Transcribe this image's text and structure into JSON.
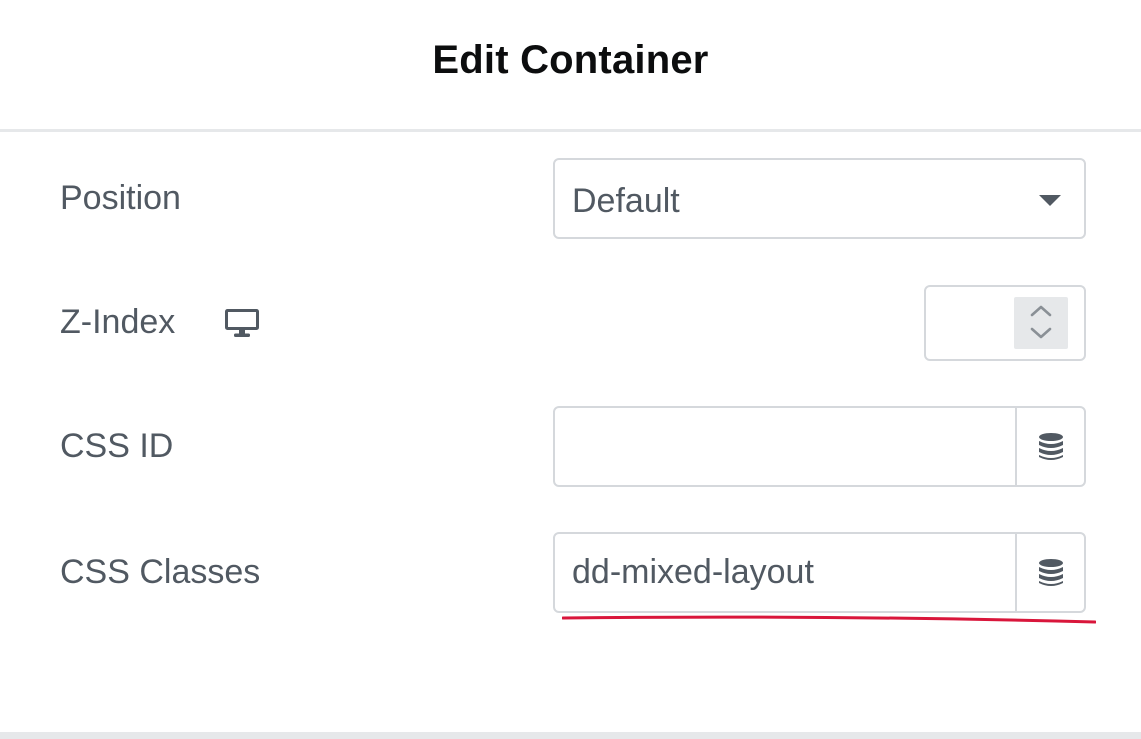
{
  "header": {
    "title": "Edit Container"
  },
  "fields": {
    "position": {
      "label": "Position",
      "value": "Default"
    },
    "z_index": {
      "label": "Z-Index",
      "value": "",
      "device_icon": "desktop-icon"
    },
    "css_id": {
      "label": "CSS ID",
      "value": "",
      "dynamic_icon": "database-icon"
    },
    "css_classes": {
      "label": "CSS Classes",
      "value": "dd-mixed-layout",
      "dynamic_icon": "database-icon"
    }
  },
  "colors": {
    "text": "#515962",
    "title": "#0c0d0e",
    "border": "#d5d8dc",
    "spinner_bg": "#e6e8ea",
    "annotation_underline": "#d9163b"
  }
}
